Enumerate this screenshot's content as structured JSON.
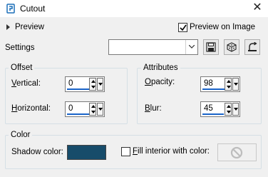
{
  "window": {
    "title": "Cutout"
  },
  "preview": {
    "label": "Preview",
    "toggle_label": "Preview on Image",
    "toggle_checked": true
  },
  "settings": {
    "label": "Settings",
    "value": ""
  },
  "offset": {
    "title": "Offset",
    "vertical": {
      "label_u": "V",
      "label_rest": "ertical:",
      "value": "0"
    },
    "horizontal": {
      "label_u": "H",
      "label_rest": "orizontal:",
      "value": "0"
    }
  },
  "attributes": {
    "title": "Attributes",
    "opacity": {
      "label_u": "O",
      "label_rest": "pacity:",
      "value": "98"
    },
    "blur": {
      "label_u": "B",
      "label_rest": "lur:",
      "value": "45"
    }
  },
  "color": {
    "title": "Color",
    "shadow_label": "Shadow color:",
    "shadow_color": "#174c6a",
    "fill_label_u": "F",
    "fill_label_rest": "ill interior with color:",
    "fill_checked": false
  },
  "colors": {
    "accent": "#1a64c8",
    "group_border": "#d5dfe5"
  }
}
